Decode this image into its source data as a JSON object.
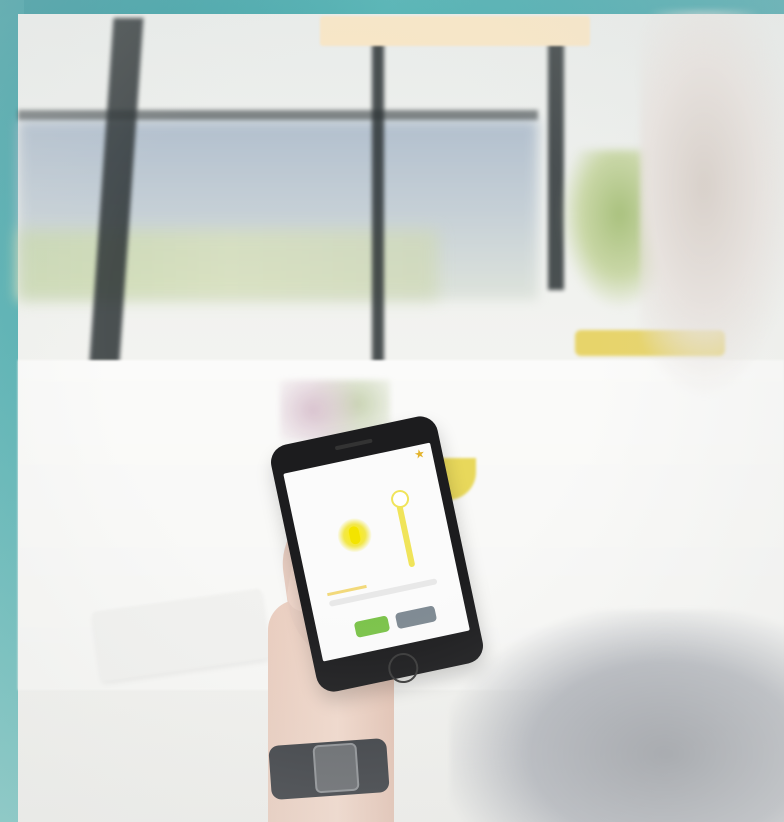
{
  "scene": {
    "colors": {
      "teal_edge": "#4aa3a8",
      "accent_yellow": "#f0e45a",
      "button_green": "#7cc34b",
      "button_gray": "#7f8a93",
      "phone_black": "#1c1c1e"
    }
  },
  "phone_app": {
    "title": "",
    "star_icon": "star-icon",
    "bulb_icon": "lightbulb-icon",
    "ok_button_label": "",
    "cancel_button_label": ""
  }
}
